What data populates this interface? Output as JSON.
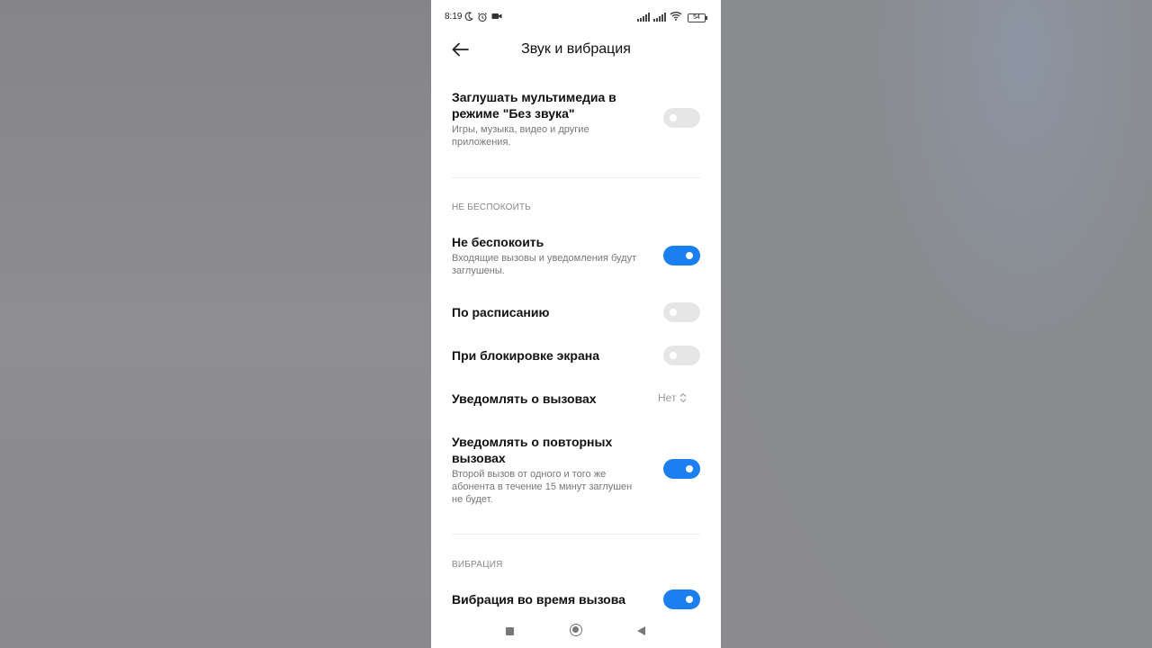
{
  "status_bar": {
    "time": "8:19",
    "battery": "54"
  },
  "header": {
    "title": "Звук и вибрация"
  },
  "mute_media": {
    "title_line1": "Заглушать мультимедиа в",
    "title_line2": "режиме \"Без звука\"",
    "subtitle_line1": "Игры, музыка, видео и другие",
    "subtitle_line2": "приложения.",
    "enabled": false
  },
  "dnd_section": {
    "label": "НЕ БЕСПОКОИТЬ",
    "dnd": {
      "title": "Не беспокоить",
      "subtitle_line1": "Входящие вызовы и уведомления будут",
      "subtitle_line2": "заглушены.",
      "enabled": true
    },
    "schedule": {
      "title": "По расписанию",
      "enabled": false
    },
    "lock_screen": {
      "title": "При блокировке экрана",
      "enabled": false
    },
    "notify_calls": {
      "title": "Уведомлять о вызовах",
      "value": "Нет"
    },
    "repeat_calls": {
      "title_line1": "Уведомлять о повторных",
      "title_line2": "вызовах",
      "subtitle_line1": "Второй вызов от одного и того же",
      "subtitle_line2": "абонента в течение 15 минут заглушен",
      "subtitle_line3": "не будет.",
      "enabled": true
    }
  },
  "vibration_section": {
    "label": "ВИБРАЦИЯ",
    "vibrate_on_call": {
      "title": "Вибрация во время вызова",
      "enabled": true
    }
  },
  "colors": {
    "accent": "#1b7ff0",
    "toggle_off": "#e6e6e6"
  },
  "icons": {
    "status": [
      "moon-icon",
      "alarm-icon",
      "video-camera-icon",
      "signal-icon",
      "wifi-icon",
      "battery-icon"
    ],
    "nav": [
      "recents-square-icon",
      "home-circle-icon",
      "back-triangle-icon"
    ]
  }
}
